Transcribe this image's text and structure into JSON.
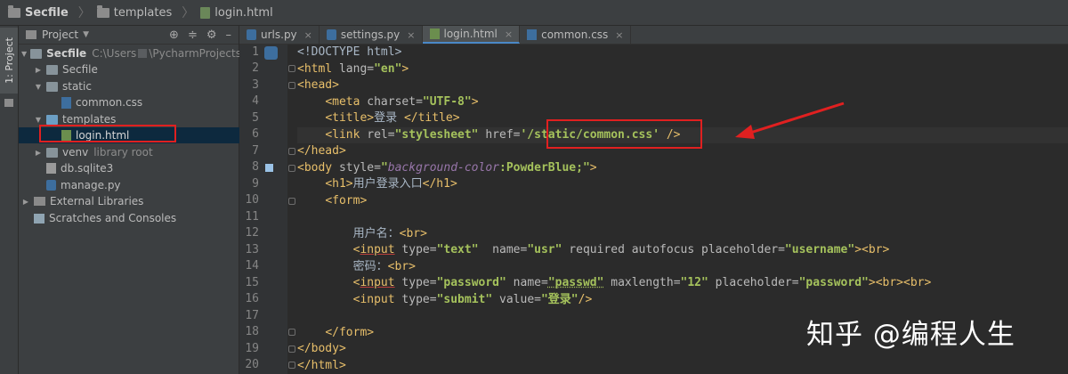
{
  "breadcrumb": {
    "project": "Secfile",
    "folder": "templates",
    "file": "login.html"
  },
  "tool_window_tab": "1: Project",
  "project_panel": {
    "title": "Project",
    "items": [
      {
        "label": "Secfile",
        "path_prefix": "C:\\Users",
        "path_suffix": "\\PycharmProjects"
      },
      {
        "label": "Secfile"
      },
      {
        "label": "static"
      },
      {
        "label": "common.css"
      },
      {
        "label": "templates"
      },
      {
        "label": "login.html"
      },
      {
        "label": "venv",
        "note": "library root"
      },
      {
        "label": "db.sqlite3"
      },
      {
        "label": "manage.py"
      },
      {
        "label": "External Libraries"
      },
      {
        "label": "Scratches and Consoles"
      }
    ]
  },
  "tabs": [
    {
      "label": "urls.py",
      "icon": "python-file-icon"
    },
    {
      "label": "settings.py",
      "icon": "python-file-icon"
    },
    {
      "label": "login.html",
      "icon": "html-file-icon",
      "active": true
    },
    {
      "label": "common.css",
      "icon": "css-file-icon"
    }
  ],
  "gutter": {
    "line_numbers": [
      "1",
      "2",
      "3",
      "4",
      "5",
      "6",
      "7",
      "8",
      "9",
      "10",
      "11",
      "12",
      "13",
      "14",
      "15",
      "16",
      "17",
      "18",
      "19",
      "20"
    ]
  },
  "code": {
    "l1": "<!DOCTYPE html>",
    "l2_tag": "<html",
    "l2_attr": " lang=",
    "l2_val": "\"en\"",
    "l2_end": ">",
    "l3": "<head>",
    "l4_tag": "<meta",
    "l4_attr": " charset=",
    "l4_val": "\"UTF-8\"",
    "l4_end": ">",
    "l5_open": "<title>",
    "l5_text": "登录 ",
    "l5_close": "</title>",
    "l6_tag": "<link",
    "l6_attr1": " rel=",
    "l6_val1": "\"stylesheet\"",
    "l6_attr2": " href=",
    "l6_val2": "'/static/common.css'",
    "l6_end": " />",
    "l7": "</head>",
    "l8_tag": "<body",
    "l8_attr": " style=",
    "l8_q1": "\"",
    "l8_prop": "background-color",
    "l8_colon": ":",
    "l8_cssval": "PowderBlue",
    "l8_semi": ";",
    "l8_q2": "\"",
    "l8_end": ">",
    "l9_open": "<h1>",
    "l9_text": "用户登录入口",
    "l9_close": "</h1>",
    "l10": "<form>",
    "l12_text": "用户名：",
    "l12_tag": "<br>",
    "l13_lt": "<",
    "l13_input": "input",
    "l13_a1": " type=",
    "l13_v1": "\"text\"",
    "l13_a2": "  name=",
    "l13_v2": "\"usr\"",
    "l13_a3": " required autofocus placeholder=",
    "l13_v3": "\"username\"",
    "l13_end": "><br>",
    "l14_text": "密码：",
    "l14_tag": "<br>",
    "l15_lt": "<",
    "l15_input": "input",
    "l15_a1": " type=",
    "l15_v1": "\"password\"",
    "l15_a2": " name=",
    "l15_v2": "\"passwd\"",
    "l15_a3": " maxlength=",
    "l15_v3": "\"12\"",
    "l15_a4": " placeholder=",
    "l15_v4": "\"password\"",
    "l15_end": "><br><br>",
    "l16_tag": "<input",
    "l16_a1": " type=",
    "l16_v1": "\"submit\"",
    "l16_a2": " value=",
    "l16_v2": "\"登录\"",
    "l16_end": "/>",
    "l18": "</form>",
    "l19": "</body>",
    "l20": "</html>"
  },
  "watermark": "知乎 @编程人生",
  "colors": {
    "annotation": "#e02020",
    "tag": "#e8bf6a",
    "string": "#a5c25c",
    "css_property": "#9876aa"
  }
}
